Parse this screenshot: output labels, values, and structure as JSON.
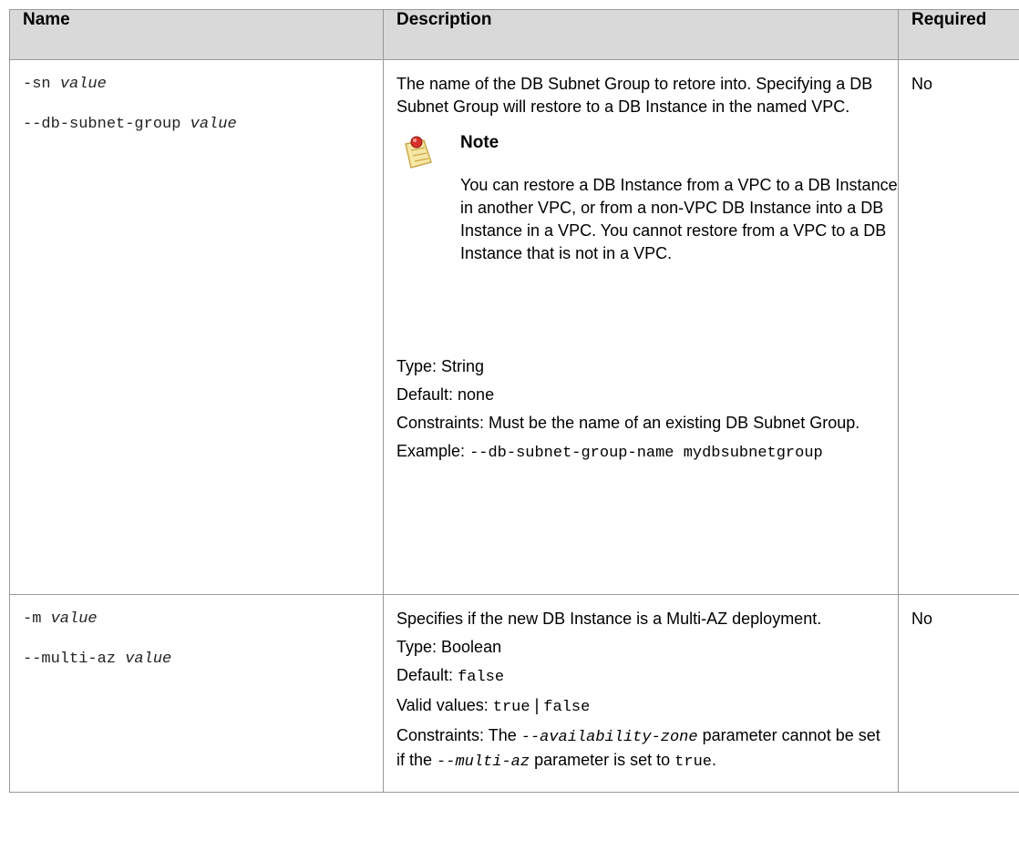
{
  "header": {
    "name": "Name",
    "description": "Description",
    "required": "Required"
  },
  "rows": [
    {
      "name_short": "-sn",
      "name_short_arg": "value",
      "name_long": "--db-subnet-group",
      "name_long_arg": "value",
      "description": "The name of the DB Subnet Group to retore into. Specifying a DB Subnet Group will restore to a DB Instance in the named VPC.",
      "note_title": "Note",
      "note_icon": "note-pushpin-icon",
      "note_text": "You can restore a DB Instance from a VPC to a DB Instance in another VPC, or from a non-VPC DB Instance into a DB Instance in a VPC. You cannot restore from a VPC to a DB Instance that is not in a VPC.",
      "type": "Type: String",
      "default": "Default: none",
      "constraints": "Constraints: Must be the name of an existing DB Subnet Group.",
      "example_label": "Example:",
      "example_value": "--db-subnet-group-name mydbsubnetgroup",
      "required": "No"
    },
    {
      "name_short": "-m",
      "name_short_arg": "value",
      "name_long": "--multi-az",
      "name_long_arg": "value",
      "description": "Specifies if the new DB Instance is a Multi-AZ deployment.",
      "type": "Type: Boolean",
      "default_label": "Default:",
      "default_value": "false",
      "valid_label": "Valid values:",
      "valid_true": "true",
      "valid_sep": "|",
      "valid_false": "false",
      "constraints_pre": "Constraints: The",
      "constraints_code1": "--availability-zone",
      "constraints_mid": "parameter cannot be set if the",
      "constraints_code2": "--multi-az",
      "constraints_post": "parameter is set to",
      "constraints_code3": "true",
      "constraints_end": ".",
      "required": "No"
    }
  ]
}
